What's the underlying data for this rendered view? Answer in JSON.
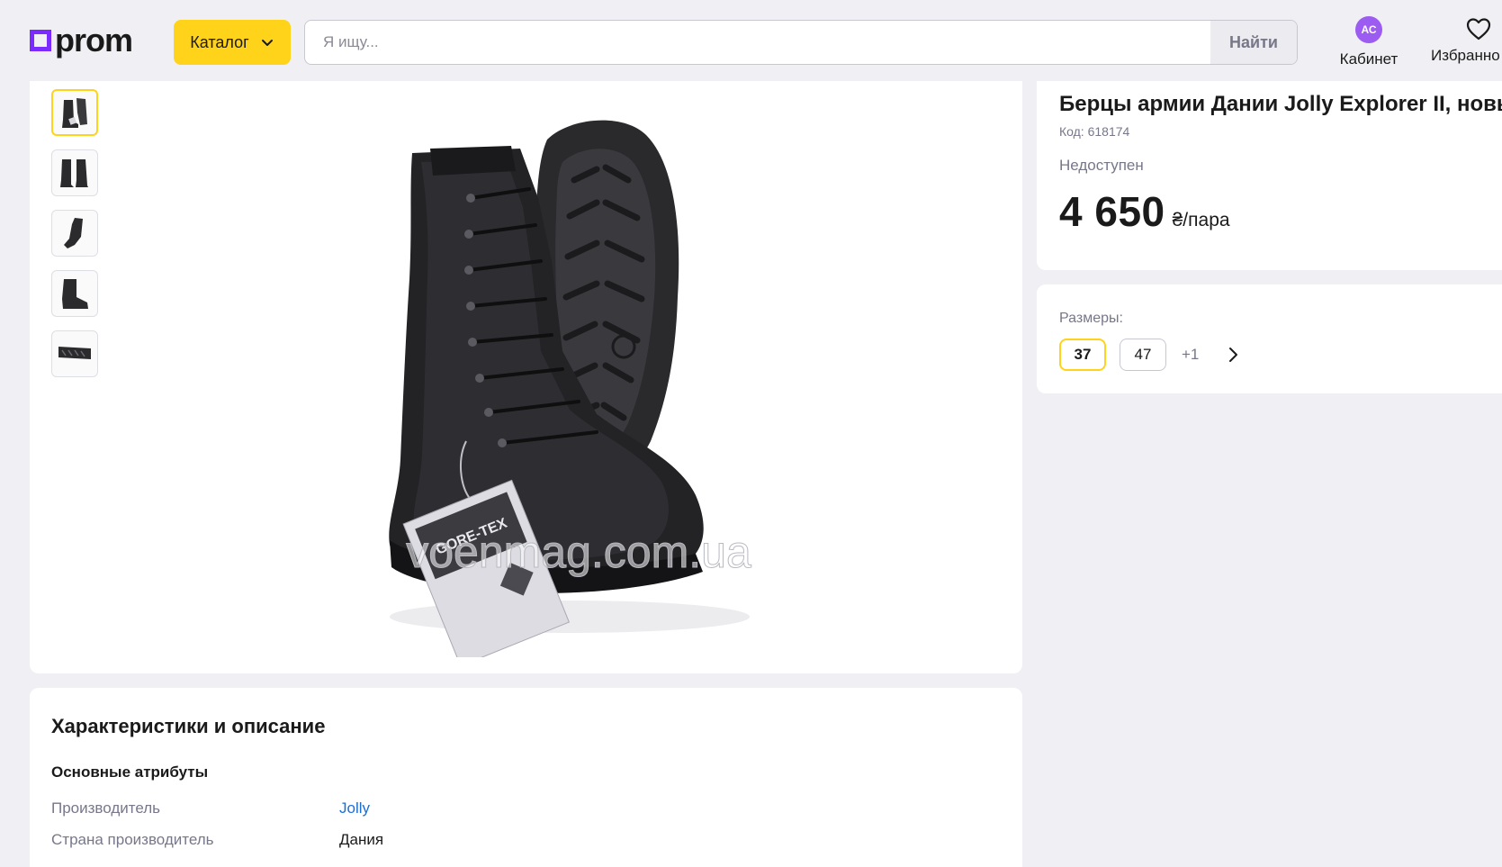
{
  "header": {
    "logo_text": "prom",
    "catalog_label": "Каталог",
    "search_placeholder": "Я ищу...",
    "search_button": "Найти",
    "cabinet_avatar": "АС",
    "cabinet_label": "Кабинет",
    "favorites_label": "Избранно"
  },
  "colors": {
    "brand_purple": "#7c2bff",
    "accent_yellow": "#ffd31a",
    "avatar_purple": "#9c5cf2",
    "link_blue": "#1a6fd6",
    "muted_text": "#77778a"
  },
  "gallery": {
    "thumbnails": [
      "boots-front",
      "boots-pair-side",
      "boot-side",
      "boot-angle",
      "boot-sole"
    ],
    "active_index": 0,
    "watermark": "voenmag.com.ua",
    "tag_text": "GORE-TEX"
  },
  "product": {
    "title": "Берцы армии Дании Jolly Explorer II, новые",
    "code": "Код: 618174",
    "availability": "Недоступен",
    "price": "4 650",
    "price_unit": "₴/пара"
  },
  "sizes": {
    "label": "Размеры:",
    "options": [
      "37",
      "47"
    ],
    "selected": "37",
    "more": "+1"
  },
  "characteristics": {
    "title": "Характеристики и описание",
    "section": "Основные атрибуты",
    "attributes": [
      {
        "name": "Производитель",
        "value": "Jolly"
      },
      {
        "name": "Страна производитель",
        "value": "Дания"
      }
    ]
  }
}
